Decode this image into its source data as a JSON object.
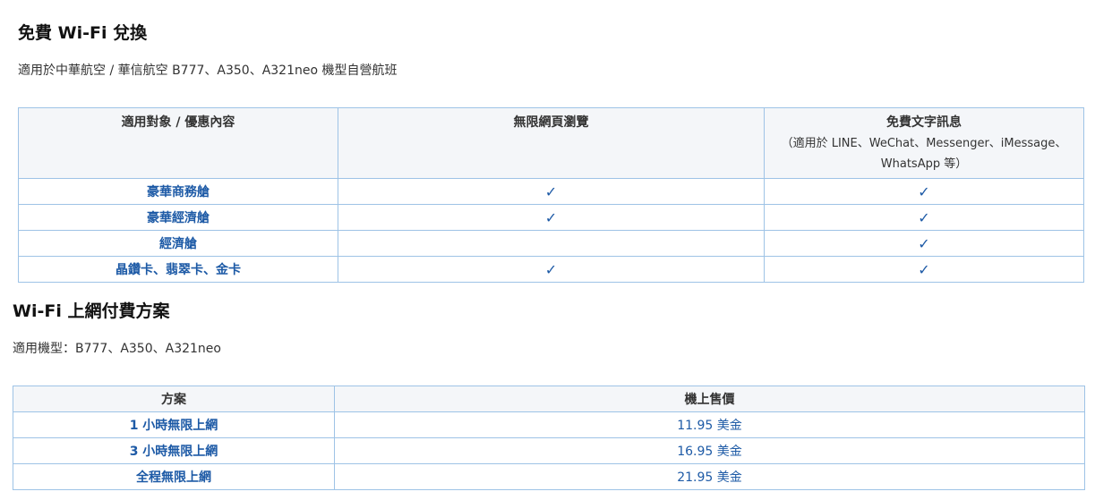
{
  "section1": {
    "title": "免費 Wi-Fi 兌換",
    "note": "適用於中華航空 / 華信航空 B777、A350、A321neo 機型自營航班"
  },
  "table1": {
    "headers": {
      "col1": "適用對象 / 優惠內容",
      "col2": "無限網頁瀏覽",
      "col3_line1": "免費文字訊息",
      "col3_line2": "（適用於 LINE、WeChat、Messenger、iMessage、",
      "col3_line3": "WhatsApp 等）"
    },
    "check_symbol": "✓",
    "rows": [
      {
        "label": "豪華商務艙",
        "browsing": "✓",
        "messaging": "✓"
      },
      {
        "label": "豪華經濟艙",
        "browsing": "✓",
        "messaging": "✓"
      },
      {
        "label": "經濟艙",
        "browsing": "",
        "messaging": "✓"
      },
      {
        "label": "晶鑽卡、翡翠卡、金卡",
        "browsing": "✓",
        "messaging": "✓"
      }
    ]
  },
  "section2": {
    "title": "Wi-Fi 上網付費方案",
    "note": "適用機型：B777、A350、A321neo"
  },
  "table2": {
    "headers": {
      "col1": "方案",
      "col2": "機上售價"
    },
    "rows": [
      {
        "plan": "1 小時無限上網",
        "price": "11.95 美金"
      },
      {
        "plan": "3 小時無限上網",
        "price": "16.95 美金"
      },
      {
        "plan": "全程無限上網",
        "price": "21.95 美金"
      }
    ]
  },
  "colors": {
    "link_blue": "#1d5aa6",
    "border": "#9ec3e6",
    "header_bg": "#f4f6f9"
  }
}
